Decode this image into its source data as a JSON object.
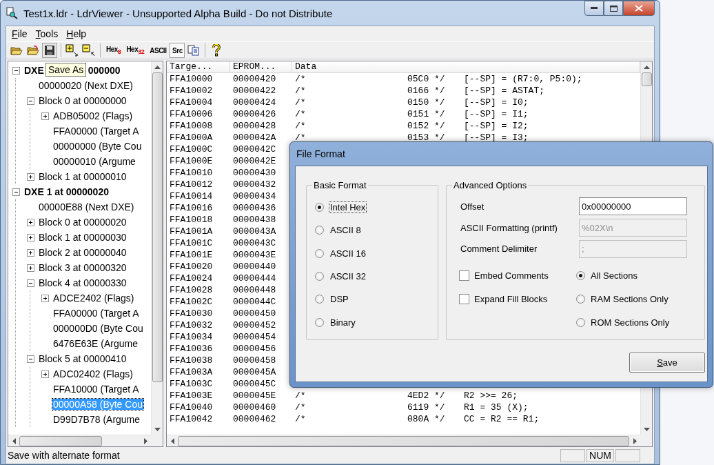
{
  "window": {
    "title": "Test1x.ldr - LdrViewer - Unsupported Alpha Build - Do not Distribute"
  },
  "menu": [
    "File",
    "Tools",
    "Help"
  ],
  "format_buttons": [
    {
      "label": "Hex$_{8}$",
      "selected": false
    },
    {
      "label": "Hex$_{32}$",
      "selected": false
    },
    {
      "label": "ASCII",
      "selected": false
    },
    {
      "label": "Src",
      "selected": true
    }
  ],
  "tooltip": "Save As",
  "tree": [
    {
      "label": "DXE",
      "label_end": "000000",
      "bold": true,
      "expanded": true,
      "selected": false,
      "children": [
        {
          "label": "00000020 (Next DXE)",
          "selected": false
        },
        {
          "label": "Block 0 at 00000000",
          "expanded": true,
          "selected": false,
          "children": [
            {
              "label": "ADB05002 (Flags)",
              "expanded": false,
              "selected": false
            },
            {
              "label": "FFA00000 (Target A",
              "selected": false
            },
            {
              "label": "00000000 (Byte Cou",
              "selected": false
            },
            {
              "label": "00000010 (Argume",
              "selected": false
            }
          ]
        },
        {
          "label": "Block 1 at 00000010",
          "expanded": false,
          "selected": false
        }
      ]
    },
    {
      "label": "DXE 1 at 00000020",
      "bold": true,
      "expanded": true,
      "selected": false,
      "children": [
        {
          "label": "00000E88 (Next DXE)",
          "selected": false
        },
        {
          "label": "Block 0 at 00000020",
          "expanded": false,
          "selected": false
        },
        {
          "label": "Block 1 at 00000030",
          "expanded": false,
          "selected": false
        },
        {
          "label": "Block 2 at 00000040",
          "expanded": false,
          "selected": false
        },
        {
          "label": "Block 3 at 00000320",
          "expanded": false,
          "selected": false
        },
        {
          "label": "Block 4 at 00000330",
          "expanded": true,
          "selected": false,
          "children": [
            {
              "label": "ADCE2402 (Flags)",
              "expanded": false,
              "selected": false
            },
            {
              "label": "FFA00000 (Target A",
              "selected": false
            },
            {
              "label": "000000D0 (Byte Cou",
              "selected": false
            },
            {
              "label": "6476E63E (Argume",
              "selected": false
            }
          ]
        },
        {
          "label": "Block 5 at 00000410",
          "expanded": true,
          "selected": false,
          "children": [
            {
              "label": "ADC02402 (Flags)",
              "expanded": false,
              "selected": false
            },
            {
              "label": "FFA10000 (Target A",
              "selected": false
            },
            {
              "label": "00000A58 (Byte Cou",
              "selected": true
            },
            {
              "label": "D99D7B78 (Argume",
              "selected": false
            }
          ]
        }
      ]
    }
  ],
  "table": {
    "columns": [
      "Targe...",
      "EPROM...",
      "Data"
    ],
    "rows": [
      {
        "target": "FFA10000",
        "eprom": "00000420",
        "comment": "/*",
        "opcode": "05C0 */",
        "instruction": "[--SP] = (R7:0, P5:0);"
      },
      {
        "target": "FFA10002",
        "eprom": "00000422",
        "comment": "/*",
        "opcode": "0166 */",
        "instruction": "[--SP] = ASTAT;"
      },
      {
        "target": "FFA10004",
        "eprom": "00000424",
        "comment": "/*",
        "opcode": "0150 */",
        "instruction": "[--SP] = I0;"
      },
      {
        "target": "FFA10006",
        "eprom": "00000426",
        "comment": "/*",
        "opcode": "0151 */",
        "instruction": "[--SP] = I1;"
      },
      {
        "target": "FFA10008",
        "eprom": "00000428",
        "comment": "/*",
        "opcode": "0152 */",
        "instruction": "[--SP] = I2;"
      },
      {
        "target": "FFA1000A",
        "eprom": "0000042A",
        "comment": "/*",
        "opcode": "0153 */",
        "instruction": "[--SP] = I3;"
      },
      {
        "target": "FFA1000C",
        "eprom": "0000042C"
      },
      {
        "target": "FFA1000E",
        "eprom": "0000042E"
      },
      {
        "target": "FFA10010",
        "eprom": "00000430"
      },
      {
        "target": "FFA10012",
        "eprom": "00000432"
      },
      {
        "target": "FFA10014",
        "eprom": "00000434"
      },
      {
        "target": "FFA10016",
        "eprom": "00000436"
      },
      {
        "target": "FFA10018",
        "eprom": "00000438"
      },
      {
        "target": "FFA1001A",
        "eprom": "0000043A"
      },
      {
        "target": "FFA1001C",
        "eprom": "0000043C"
      },
      {
        "target": "FFA1001E",
        "eprom": "0000043E"
      },
      {
        "target": "FFA10020",
        "eprom": "00000440"
      },
      {
        "target": "FFA10024",
        "eprom": "00000444"
      },
      {
        "target": "FFA10028",
        "eprom": "00000448"
      },
      {
        "target": "FFA1002C",
        "eprom": "0000044C"
      },
      {
        "target": "FFA10030",
        "eprom": "00000450"
      },
      {
        "target": "FFA10032",
        "eprom": "00000452"
      },
      {
        "target": "FFA10034",
        "eprom": "00000454"
      },
      {
        "target": "FFA10036",
        "eprom": "00000456"
      },
      {
        "target": "FFA10038",
        "eprom": "00000458"
      },
      {
        "target": "FFA1003A",
        "eprom": "0000045A"
      },
      {
        "target": "FFA1003C",
        "eprom": "0000045C"
      },
      {
        "target": "FFA1003E",
        "eprom": "0000045E",
        "comment": "/*",
        "opcode": "4ED2 */",
        "instruction": "R2 >>= 26;"
      },
      {
        "target": "FFA10040",
        "eprom": "00000460",
        "comment": "/*",
        "opcode": "6119 */",
        "instruction": "R1 = 35 (X);"
      },
      {
        "target": "FFA10042",
        "eprom": "00000462",
        "comment": "/*",
        "opcode": "080A */",
        "instruction": "CC = R2 == R1;"
      }
    ]
  },
  "status_bar": {
    "text": "Save with alternate format",
    "indicators": [
      "NUM"
    ]
  },
  "dialog": {
    "title": "File Format",
    "basic_format": {
      "title": "Basic Format",
      "options": [
        {
          "label": "Intel Hex",
          "selected": true
        },
        {
          "label": "ASCII 8",
          "selected": false
        },
        {
          "label": "ASCII 16",
          "selected": false
        },
        {
          "label": "ASCII 32",
          "selected": false
        },
        {
          "label": "DSP",
          "selected": false
        },
        {
          "label": "Binary",
          "selected": false
        }
      ]
    },
    "advanced_options": {
      "title": "Advanced Options",
      "fields": [
        {
          "label": "Offset",
          "value": "0x00000000",
          "disabled": false
        },
        {
          "label": "ASCII Formatting (printf)",
          "value": "%02X\\n",
          "disabled": true
        },
        {
          "label": "Comment Delimiter",
          "value": ";",
          "disabled": true
        }
      ],
      "checkboxes": [
        {
          "label": "Embed Comments",
          "checked": false
        },
        {
          "label": "Expand Fill Blocks",
          "checked": false
        }
      ],
      "sections": [
        {
          "label": "All Sections",
          "selected": true
        },
        {
          "label": "RAM Sections Only",
          "selected": false
        },
        {
          "label": "ROM Sections Only",
          "selected": false
        }
      ]
    },
    "buttons": [
      "Save"
    ]
  }
}
